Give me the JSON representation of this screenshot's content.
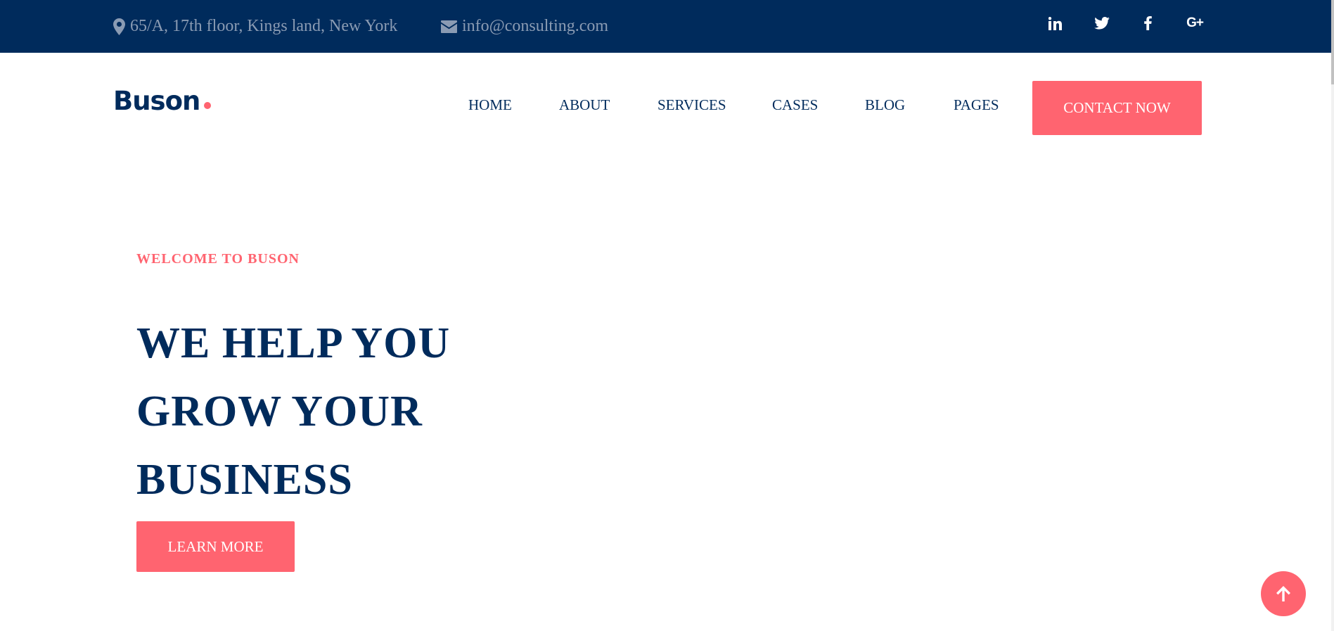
{
  "topbar": {
    "address": "65/A, 17th floor, Kings land, New York",
    "email": "info@consulting.com",
    "social": [
      "linkedin-icon",
      "twitter-icon",
      "facebook-icon",
      "google-plus-icon"
    ],
    "gplus_label": "G+"
  },
  "header": {
    "logo": "Buson",
    "nav": [
      "HOME",
      "ABOUT",
      "SERVICES",
      "CASES",
      "BLOG",
      "PAGES"
    ],
    "contact_button": "CONTACT NOW"
  },
  "hero": {
    "eyebrow": "WELCOME TO BUSON",
    "headline_lines": [
      "WE HELP YOU",
      "GROW YOUR",
      "BUSINESS"
    ],
    "button": "LEARN MORE"
  },
  "colors": {
    "navy": "#002b5c",
    "accent": "#ff6470",
    "muted": "#8a9bb3"
  },
  "scroll_to_top_icon": "arrow-up-icon"
}
